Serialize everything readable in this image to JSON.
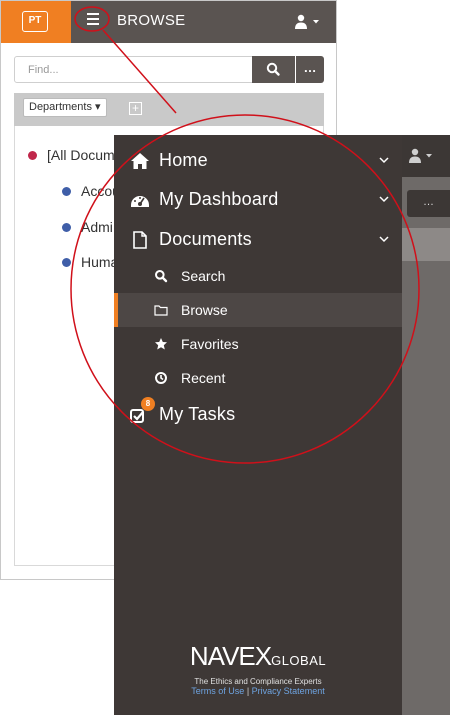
{
  "app": {
    "logo_text": "PT",
    "page_title": "BROWSE",
    "brand_color": "#f07f22",
    "header_color": "#5a5451"
  },
  "search": {
    "placeholder": "Find...",
    "more_label": "…"
  },
  "toolbar": {
    "departments_label": "Departments ▾",
    "add_label": "+"
  },
  "tree": {
    "items": [
      {
        "label": "[All Docum",
        "dot_color": "#c0274b"
      },
      {
        "label": "Accou",
        "dot_color": "#3f5ea8"
      },
      {
        "label": "Admi",
        "dot_color": "#3f5ea8"
      },
      {
        "label": "Huma",
        "dot_color": "#3f5ea8"
      }
    ]
  },
  "drawer": {
    "items": [
      {
        "label": "Home",
        "icon": "home-icon"
      },
      {
        "label": "My Dashboard",
        "icon": "dashboard-icon"
      },
      {
        "label": "Documents",
        "icon": "document-icon"
      }
    ],
    "sub_items": [
      {
        "label": "Search",
        "icon": "search-icon"
      },
      {
        "label": "Browse",
        "icon": "folder-icon",
        "active": true
      },
      {
        "label": "Favorites",
        "icon": "star-icon"
      },
      {
        "label": "Recent",
        "icon": "clock-icon"
      }
    ],
    "tasks": {
      "label": "My Tasks",
      "icon": "tasks-icon",
      "badge": "8"
    },
    "footer": {
      "brand_main": "NAVEX",
      "brand_small": "GLOBAL",
      "tagline": "The Ethics and Compliance Experts",
      "terms_label": "Terms of Use",
      "separator": "|",
      "privacy_label": "Privacy Statement"
    }
  },
  "annotation": {
    "color": "#d0101a"
  }
}
